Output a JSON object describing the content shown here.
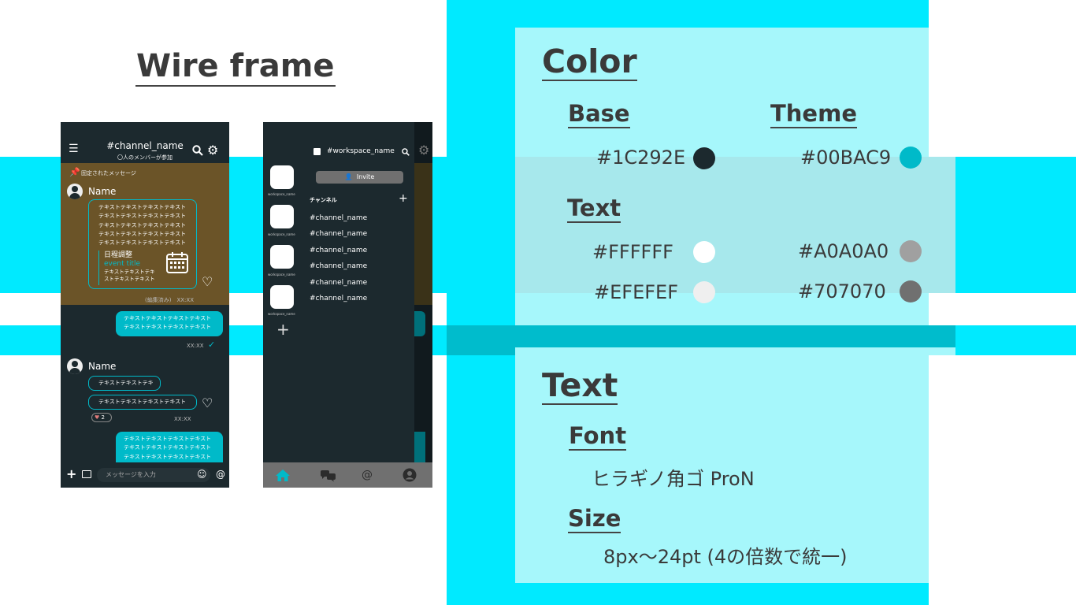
{
  "wireframe": {
    "title": "Wire frame",
    "chat": {
      "channel": "#channel_name",
      "members": "〇人のメンバーが参加",
      "pinned_label": "固定されたメッセージ",
      "name1": "Name",
      "text_line": "テキストテキストテキストテキスト",
      "schedule_title": "日程調整",
      "event_title": "event title",
      "event_line1": "テキストテキストテキ",
      "event_line2": "ストテキストテキスト",
      "edited": "(編集済み)　XX:XX",
      "sent_line": "テキストテキストテキストテキスト",
      "time1": "XX:XX",
      "name2": "Name",
      "short_msg": "テキストテキストテキ",
      "long_msg": "テキストテキストテキストテキスト",
      "reaction_count": "2",
      "time2": "XX:XX",
      "sent2_line": "テキストテキストテキストテキスト",
      "input_placeholder": "メッセージを入力"
    },
    "drawer": {
      "workspace": "#workspace_name",
      "invite": "Invite",
      "channels_header": "チャンネル",
      "ws_label": "workspace_name",
      "channels": [
        "#channel_name",
        "#channel_name",
        "#channel_name",
        "#channel_name",
        "#channel_name",
        "#channel_name"
      ]
    }
  },
  "guide": {
    "color_heading": "Color",
    "base_heading": "Base",
    "theme_heading": "Theme",
    "base_hex": "#1C292E",
    "theme_hex": "#00BAC9",
    "text_heading": "Text",
    "text_colors": [
      "#FFFFFF",
      "#A0A0A0",
      "#EFEFEF",
      "#707070"
    ],
    "text_section_heading": "Text",
    "font_heading": "Font",
    "font_name": "ヒラギノ角ゴ ProN",
    "size_heading": "Size",
    "size_value": "8px〜24pt (4の倍数で統一)"
  },
  "colors": {
    "base": "#1C292E",
    "theme": "#00BAC9",
    "white": "#FFFFFF",
    "gray1": "#A0A0A0",
    "light": "#EFEFEF",
    "gray2": "#707070"
  }
}
